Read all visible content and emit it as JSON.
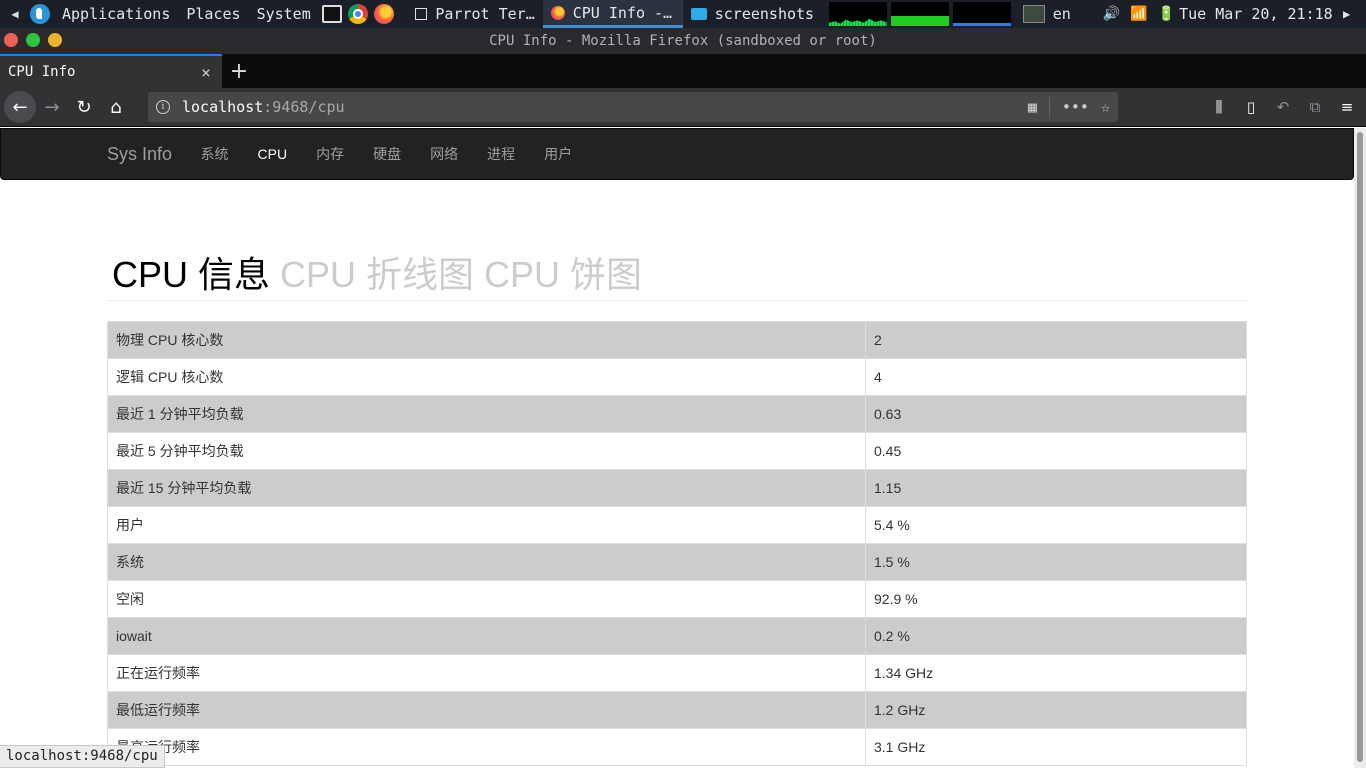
{
  "os_panel": {
    "menus": [
      "Applications",
      "Places",
      "System"
    ],
    "tasks": [
      {
        "label": "Parrot Ter…",
        "icon": "terminal-icon",
        "active": false
      },
      {
        "label": "CPU Info -…",
        "icon": "firefox-icon",
        "active": true
      },
      {
        "label": "screenshots",
        "icon": "folder-icon",
        "active": false
      }
    ],
    "lang": "en",
    "clock": "Tue Mar 20, 21:18"
  },
  "window": {
    "title": "CPU Info - Mozilla Firefox (sandboxed or root)"
  },
  "tab": {
    "title": "CPU Info",
    "close": "×",
    "new_tab": "+"
  },
  "urlbar": {
    "host": "localhost",
    "path": ":9468/cpu"
  },
  "site_nav": {
    "brand": "Sys Info",
    "links": [
      "系统",
      "CPU",
      "内存",
      "硬盘",
      "网络",
      "进程",
      "用户"
    ],
    "active": "CPU"
  },
  "heading": {
    "main": "CPU 信息",
    "sub": "CPU 折线图 CPU 饼图"
  },
  "rows": [
    {
      "key": "物理 CPU 核心数",
      "value": "2"
    },
    {
      "key": "逻辑 CPU 核心数",
      "value": "4"
    },
    {
      "key": "最近 1 分钟平均负载",
      "value": "0.63"
    },
    {
      "key": "最近 5 分钟平均负载",
      "value": "0.45"
    },
    {
      "key": "最近 15 分钟平均负载",
      "value": "1.15"
    },
    {
      "key": "用户",
      "value": "5.4 %"
    },
    {
      "key": "系统",
      "value": "1.5 %"
    },
    {
      "key": "空闲",
      "value": "92.9 %"
    },
    {
      "key": "iowait",
      "value": "0.2 %"
    },
    {
      "key": "正在运行频率",
      "value": "1.34 GHz"
    },
    {
      "key": "最低运行频率",
      "value": "1.2 GHz"
    },
    {
      "key": "最高运行频率",
      "value": "3.1 GHz"
    }
  ],
  "status_url": "localhost:9468/cpu"
}
